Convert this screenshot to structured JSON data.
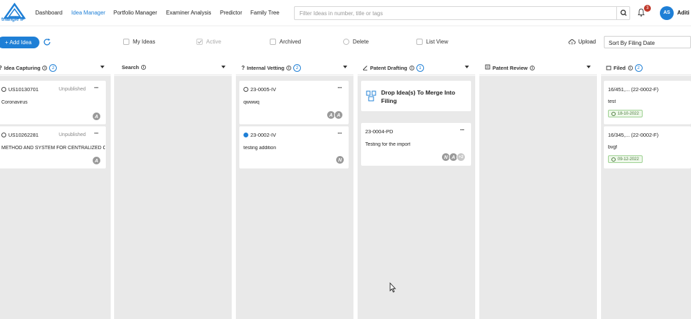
{
  "brand": {
    "logo_text": "triangle IP",
    "color": "#1e7fd6"
  },
  "nav": {
    "links": [
      "Dashboard",
      "Idea Manager",
      "Portfolio Manager",
      "Examiner Analysis",
      "Predictor",
      "Family Tree"
    ],
    "active": "Idea Manager"
  },
  "search": {
    "placeholder": "Filter Ideas in number, title or tags"
  },
  "notifications": {
    "count": "3"
  },
  "user": {
    "initials": "AS",
    "name": "Aditi S"
  },
  "toolbar": {
    "add_label": "+ Add Idea",
    "filters": [
      "My Ideas",
      "Active",
      "Archived",
      "Delete",
      "List View"
    ],
    "upload_label": "Upload",
    "sort_label": "Sort By Filing Date"
  },
  "columns": [
    {
      "title": "Idea Capturing",
      "count": "2",
      "icon": "question-icon",
      "cards": [
        {
          "id": "US10130701",
          "status": "Unpublished",
          "text": "Coronavirus",
          "avatars": [
            "A"
          ]
        },
        {
          "id": "US10262281",
          "status": "Unpublished",
          "text": "METHOD AND SYSTEM FOR CENTRALIZED ORDE...",
          "avatars": [
            "A"
          ]
        }
      ]
    },
    {
      "title": "Search",
      "count": "",
      "icon": "",
      "cards": []
    },
    {
      "title": "Internal Vetting",
      "count": "2",
      "icon": "question-icon",
      "cards": [
        {
          "id": "23-0005-IV",
          "status": "",
          "text": "qwwwq",
          "avatars": [
            "A",
            "A"
          ]
        },
        {
          "id": "23-0002-IV",
          "status": "",
          "text": "testing addition",
          "avatars": [
            "N"
          ]
        }
      ]
    },
    {
      "title": "Patent Drafting",
      "count": "1",
      "icon": "pencil-icon",
      "drop_label": "Drop Idea(s) To Merge Into Filing",
      "cards": [
        {
          "id": "23-0004-PD",
          "status": "",
          "text": "Testing for the import",
          "avatars": [
            "N",
            "A",
            "+2"
          ]
        }
      ]
    },
    {
      "title": "Patent Review",
      "count": "",
      "icon": "review-icon",
      "cards": []
    },
    {
      "title": "Filed",
      "count": "2",
      "icon": "archive-icon",
      "cards": [
        {
          "id": "16/451,... (22-0002-F)",
          "status": "",
          "text": "test",
          "date": "18-10-2022",
          "avatars": []
        },
        {
          "id": "16/345,... (22-0002-F)",
          "status": "",
          "text": "bvgf",
          "date": "09-12-2022",
          "avatars": []
        }
      ]
    }
  ]
}
